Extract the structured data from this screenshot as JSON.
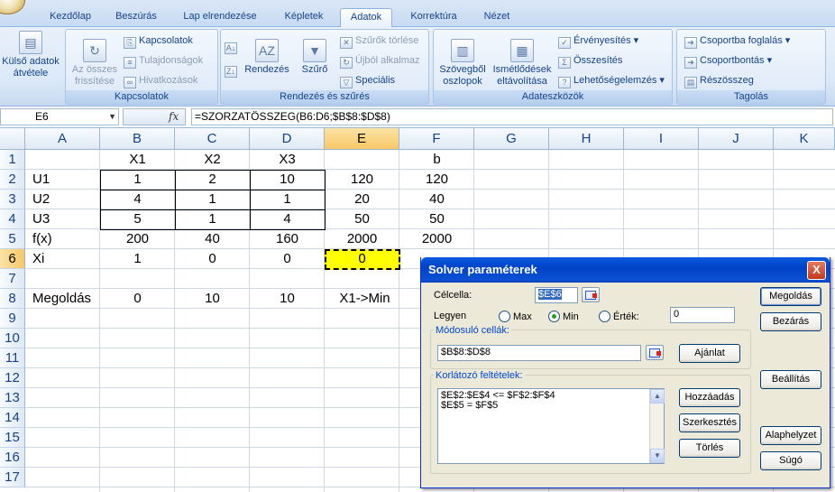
{
  "ribbon": {
    "tabs": [
      "Kezdőlap",
      "Beszúrás",
      "Lap elrendezése",
      "Képletek",
      "Adatok",
      "Korrektúra",
      "Nézet"
    ],
    "active_tab": "Adatok",
    "groups": {
      "external": {
        "label_line1": "Külső adatok",
        "label_line2": "átvétele"
      },
      "connections": {
        "title": "Kapcsolatok",
        "refresh_line1": "Az összes",
        "refresh_line2": "frissítése",
        "items": [
          "Kapcsolatok",
          "Tulajdonságok",
          "Hivatkozások"
        ]
      },
      "sort": {
        "title": "Rendezés és szűrés",
        "sort": "Rendezés",
        "filter": "Szűrő",
        "clear": "Szűrők törlése",
        "reapply": "Újból alkalmaz",
        "advanced": "Speciális"
      },
      "tools": {
        "title": "Adateszközök",
        "text_cols_line1": "Szövegből",
        "text_cols_line2": "oszlopok",
        "dups_line1": "Ismétlődések",
        "dups_line2": "eltávolítása",
        "validation": "Érvényesítés",
        "consolidate": "Összesítés",
        "whatif": "Lehetőségelemzés"
      },
      "outline": {
        "title": "Tagolás",
        "group": "Csoportba foglalás",
        "ungroup": "Csoportbontás",
        "subtotal": "Részösszeg"
      }
    }
  },
  "formula_bar": {
    "name_box": "E6",
    "fx": "fx",
    "formula": "=SZORZATÖSSZEG(B6:D6;$B$8:$D$8)"
  },
  "sheet": {
    "columns": [
      "A",
      "B",
      "C",
      "D",
      "E",
      "F",
      "G",
      "H",
      "I",
      "J",
      "K"
    ],
    "selected_column": "E",
    "rows": [
      "1",
      "2",
      "3",
      "4",
      "5",
      "6",
      "7",
      "8",
      "9",
      "10",
      "11",
      "12",
      "13",
      "14",
      "15",
      "16",
      "17"
    ],
    "selected_row": "6",
    "cells": {
      "B1": "X1",
      "C1": "X2",
      "D1": "X3",
      "F1": "b",
      "A2": "U1",
      "B2": "1",
      "C2": "2",
      "D2": "10",
      "E2": "120",
      "F2": "120",
      "A3": "U2",
      "B3": "4",
      "C3": "1",
      "D3": "1",
      "E3": "20",
      "F3": "40",
      "A4": "U3",
      "B4": "5",
      "C4": "1",
      "D4": "4",
      "E4": "50",
      "F4": "50",
      "A5": "f(x)",
      "B5": "200",
      "C5": "40",
      "D5": "160",
      "E5": "2000",
      "F5": "2000",
      "A6": "Xi",
      "B6": "1",
      "C6": "0",
      "D6": "0",
      "E6": "0",
      "A8": "Megoldás",
      "B8": "0",
      "C8": "10",
      "D8": "10",
      "E8": "X1->Min"
    }
  },
  "solver": {
    "title": "Solver paraméterek",
    "close": "X",
    "target_label": "Célcella:",
    "target_value": "$E$6",
    "equal_label": "Legyen",
    "opt_max": "Max",
    "opt_min": "Min",
    "opt_value": "Érték:",
    "value_field": "0",
    "selected_option": "Min",
    "changing_label": "Módosuló cellák:",
    "changing_value": "$B$8:$D$8",
    "guess_button": "Ajánlat",
    "constraints_label": "Korlátozó feltételek:",
    "constraints": [
      "$E$2:$E$4 <= $F$2:$F$4",
      "$E$5 = $F$5"
    ],
    "add_button": "Hozzáadás",
    "edit_button": "Szerkesztés",
    "delete_button": "Törlés",
    "solve_button": "Megoldás",
    "close_button": "Bezárás",
    "options_button": "Beállítás",
    "reset_button": "Alaphelyzet",
    "help_button": "Súgó"
  }
}
